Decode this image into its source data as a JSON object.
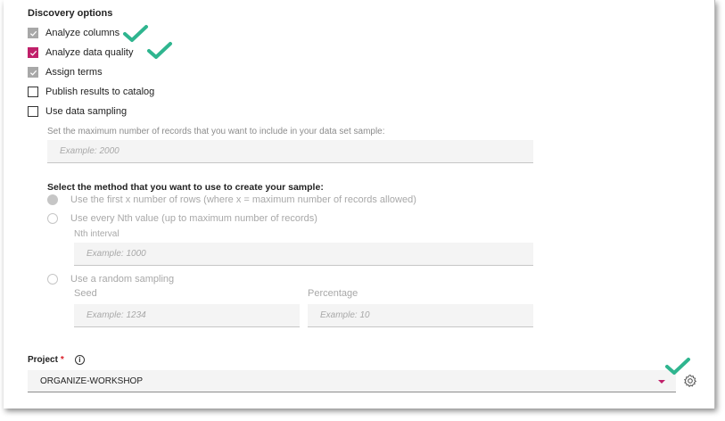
{
  "section": {
    "title": "Discovery options"
  },
  "checkboxes": [
    {
      "label": "Analyze columns",
      "state": "checked-disabled"
    },
    {
      "label": "Analyze data quality",
      "state": "checked"
    },
    {
      "label": "Assign terms",
      "state": "checked-disabled"
    },
    {
      "label": "Publish results to catalog",
      "state": "unchecked"
    },
    {
      "label": "Use data sampling",
      "state": "unchecked"
    }
  ],
  "sampling": {
    "max_records_label": "Set the maximum number of records that you want to include in your data set sample:",
    "max_records_placeholder": "Example: 2000",
    "method_title": "Select the method that you want to use to create your sample:",
    "methods": [
      {
        "label": "Use the first x number of rows (where x = maximum number of records allowed)",
        "selected": true
      },
      {
        "label": "Use every Nth value (up to maximum number of records)",
        "selected": false
      },
      {
        "label": "Use a random sampling",
        "selected": false
      }
    ],
    "nth_interval_label": "Nth interval",
    "nth_interval_placeholder": "Example: 1000",
    "seed_label": "Seed",
    "seed_placeholder": "Example: 1234",
    "percentage_label": "Percentage",
    "percentage_placeholder": "Example: 10"
  },
  "project": {
    "label": "Project",
    "required_mark": "*",
    "info_glyph": "i",
    "value": "ORGANIZE-WORKSHOP"
  },
  "colors": {
    "accent": "#c0206a",
    "annotation_check": "#2fb58f",
    "disabled": "#a8a8a8"
  },
  "icons": [
    "check-icon",
    "info-icon",
    "chevron-down-icon",
    "gear-icon",
    "annotation-checkmark-icon"
  ]
}
